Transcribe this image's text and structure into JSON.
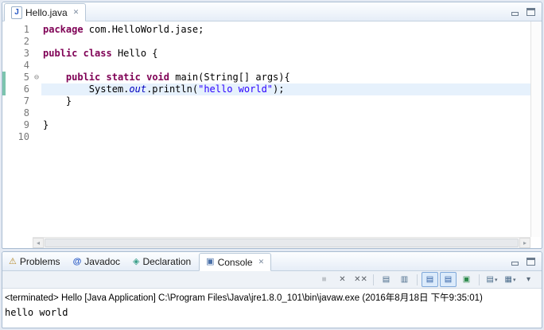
{
  "editor": {
    "tab": {
      "icon": "J",
      "label": "Hello.java",
      "close_glyph": "✕"
    },
    "fold_glyph": "⊖",
    "lines": [
      {
        "n": "1",
        "segs": [
          {
            "s": "k",
            "t": "package"
          },
          {
            "s": "p",
            "t": " com.HelloWorld.jase;"
          }
        ]
      },
      {
        "n": "2",
        "segs": []
      },
      {
        "n": "3",
        "segs": [
          {
            "s": "k",
            "t": "public"
          },
          {
            "s": "p",
            "t": " "
          },
          {
            "s": "k",
            "t": "class"
          },
          {
            "s": "p",
            "t": " Hello {"
          }
        ]
      },
      {
        "n": "4",
        "segs": []
      },
      {
        "n": "5",
        "fold": true,
        "range": true,
        "segs": [
          {
            "s": "p",
            "t": "    "
          },
          {
            "s": "k",
            "t": "public"
          },
          {
            "s": "p",
            "t": " "
          },
          {
            "s": "k",
            "t": "static"
          },
          {
            "s": "p",
            "t": " "
          },
          {
            "s": "k",
            "t": "void"
          },
          {
            "s": "p",
            "t": " main(String[] args){"
          }
        ]
      },
      {
        "n": "6",
        "hl": true,
        "range": true,
        "segs": [
          {
            "s": "p",
            "t": "        System."
          },
          {
            "s": "f",
            "t": "out"
          },
          {
            "s": "p",
            "t": ".println("
          },
          {
            "s": "str",
            "t": "\"hello world\""
          },
          {
            "s": "p",
            "t": ");"
          }
        ]
      },
      {
        "n": "7",
        "segs": [
          {
            "s": "p",
            "t": "    }"
          }
        ]
      },
      {
        "n": "8",
        "segs": []
      },
      {
        "n": "9",
        "segs": [
          {
            "s": "p",
            "t": "}"
          }
        ]
      },
      {
        "n": "10",
        "segs": []
      }
    ],
    "scrollbar": {
      "left_glyph": "◂",
      "right_glyph": "▸"
    }
  },
  "console_area": {
    "tabs": [
      {
        "label": "Problems",
        "icon": "⚠"
      },
      {
        "label": "Javadoc",
        "icon": "@"
      },
      {
        "label": "Declaration",
        "icon": "◈"
      },
      {
        "label": "Console",
        "icon": "▣",
        "selected": true,
        "close_glyph": "✕"
      }
    ],
    "toolbar": [
      {
        "name": "terminate",
        "glyph": "■",
        "state": "disabled",
        "color": "#8a9096"
      },
      {
        "name": "remove-launch",
        "glyph": "✕",
        "state": "normal",
        "color": "#5a5f66"
      },
      {
        "name": "remove-all-terminated",
        "glyph": "✕✕",
        "state": "normal",
        "color": "#5a5f66"
      },
      {
        "sep": true
      },
      {
        "name": "clear-console",
        "glyph": "▤",
        "state": "normal",
        "color": "#4a6b8a"
      },
      {
        "name": "scroll-lock",
        "glyph": "▥",
        "state": "normal",
        "color": "#4a6b8a"
      },
      {
        "sep": true
      },
      {
        "name": "show-console-on-stdout",
        "glyph": "▤",
        "state": "pressed",
        "color": "#2f5fa3"
      },
      {
        "name": "show-console-on-stderr",
        "glyph": "▤",
        "state": "pressed",
        "color": "#2f5fa3"
      },
      {
        "name": "pin-console",
        "glyph": "▣",
        "state": "normal",
        "color": "#2c8a4b"
      },
      {
        "sep": true
      },
      {
        "name": "display-selected-console",
        "glyph": "▤",
        "state": "normal",
        "color": "#4a6b8a",
        "dropdown": true
      },
      {
        "name": "open-console",
        "glyph": "▦",
        "state": "normal",
        "color": "#4a6b8a",
        "dropdown": true
      },
      {
        "name": "view-menu",
        "glyph": "▾",
        "state": "normal",
        "color": "#5a6a7a"
      }
    ],
    "status_line": "<terminated> Hello [Java Application] C:\\Program Files\\Java\\jre1.8.0_101\\bin\\javaw.exe (2016年8月18日 下午9:35:01)",
    "output": "hello world"
  },
  "colors": {
    "keyword": "#7f0055",
    "string": "#2a00ff",
    "static_field": "#0000c0",
    "current_line_highlight": "#e6f1fc",
    "range_indicator": "#7cc4ae",
    "part_border": "#a9bcd1"
  }
}
